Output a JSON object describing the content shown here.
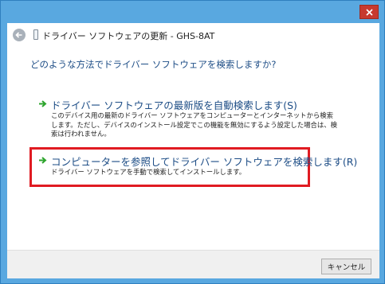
{
  "window": {
    "title": "ドライバー ソフトウェアの更新 - GHS-8AT",
    "close_icon": "close-icon"
  },
  "nav": {
    "back_icon": "back-arrow-icon",
    "device_icon": "device-icon"
  },
  "main": {
    "question": "どのような方法でドライバー ソフトウェアを検索しますか?",
    "options": [
      {
        "title": "ドライバー ソフトウェアの最新版を自動検索します(S)",
        "description": "このデバイス用の最新のドライバー ソフトウェアをコンピューターとインターネットから検索します。ただし、デバイスのインストール設定でこの機能を無効にするよう設定した場合は、検索は行われません。",
        "icon": "green-arrow-icon"
      },
      {
        "title": "コンピューターを参照してドライバー ソフトウェアを検索します(R)",
        "description": "ドライバー ソフトウェアを手動で検索してインストールします。",
        "icon": "green-arrow-icon",
        "highlight_color": "#e01b22"
      }
    ]
  },
  "footer": {
    "cancel_label": "キャンセル"
  },
  "colors": {
    "frame": "#59a8e0",
    "link": "#1d4d86",
    "close": "#c7392e",
    "arrow": "#2ea52e"
  }
}
